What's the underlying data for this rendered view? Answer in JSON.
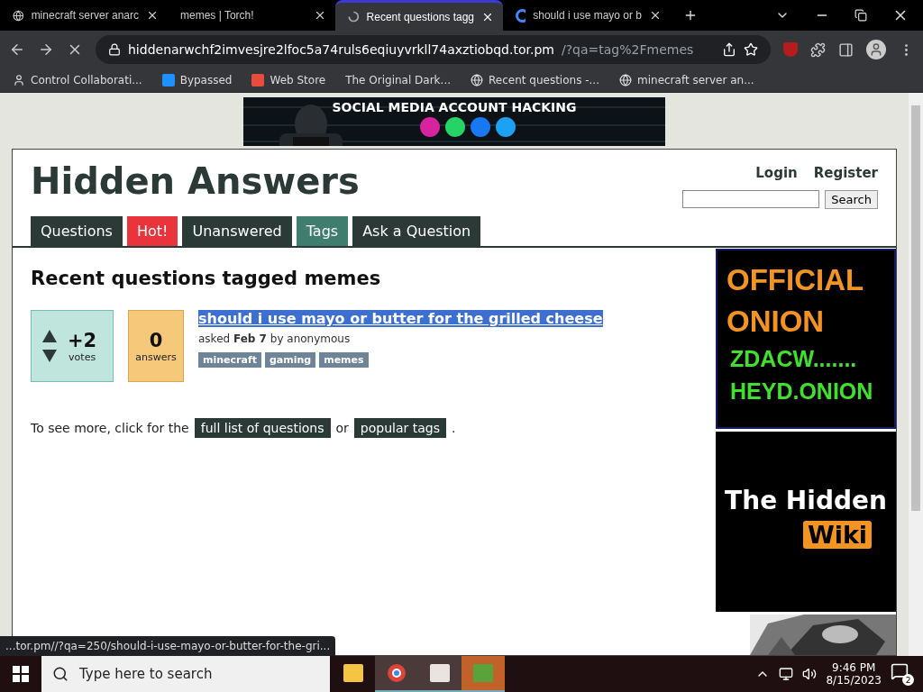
{
  "browser": {
    "tabs": [
      {
        "title": "minecraft server anarc",
        "selected": false
      },
      {
        "title": "memes | Torch!",
        "selected": false
      },
      {
        "title": "Recent questions tagg",
        "selected": true
      },
      {
        "title": "should i use mayo or b",
        "selected": false
      }
    ],
    "url": {
      "host": "hiddenarwchf2imvesjre2lfoc5a74ruls6eqiuyvrkll74axztiobqd.tor.pm",
      "path": "/?qa=tag%2Fmemes"
    },
    "bookmarks": [
      {
        "label": "Control Collaborati..."
      },
      {
        "label": "Bypassed"
      },
      {
        "label": "Web Store"
      },
      {
        "label": "The Original Dark..."
      },
      {
        "label": "Recent questions -..."
      },
      {
        "label": "minecraft server an..."
      }
    ]
  },
  "banner": {
    "title": "SOCIAL MEDIA ACCOUNT HACKING"
  },
  "site": {
    "title": "Hidden Answers",
    "login": "Login",
    "register": "Register",
    "search_button": "Search"
  },
  "nav": [
    {
      "label": "Questions",
      "selected": false,
      "kind": "normal"
    },
    {
      "label": "Hot!",
      "selected": false,
      "kind": "hot"
    },
    {
      "label": "Unanswered",
      "selected": false,
      "kind": "normal"
    },
    {
      "label": "Tags",
      "selected": true,
      "kind": "normal"
    },
    {
      "label": "Ask a Question",
      "selected": false,
      "kind": "normal"
    }
  ],
  "heading": "Recent questions tagged memes",
  "question": {
    "votes": "+2",
    "votes_label": "votes",
    "answers": "0",
    "answers_label": "answers",
    "title": "should i use mayo or butter for the grilled cheese",
    "highlighted": true,
    "asked": "asked",
    "date": "Feb 7",
    "by": "by",
    "user": "anonymous",
    "tags": [
      "minecraft",
      "gaming",
      "memes"
    ]
  },
  "more": {
    "text": "To see more, click for the",
    "link_1": "full list of questions",
    "or": "or",
    "link_2": "popular tags",
    "end": "."
  },
  "ads": {
    "onion_lines": [
      "OFFICIAL",
      "ONION"
    ],
    "code_lines": [
      "ZDACW.......",
      "HEYD.ONION"
    ],
    "wiki_title": "The Hidden",
    "wiki_badge": "Wiki"
  },
  "status_url": "...tor.pm//?qa=250/should-i-use-mayo-or-butter-for-the-gri...",
  "taskbar": {
    "search_placeholder": "Type here to search",
    "time": "9:46 PM",
    "date": "8/15/2023",
    "notifications": "2"
  }
}
